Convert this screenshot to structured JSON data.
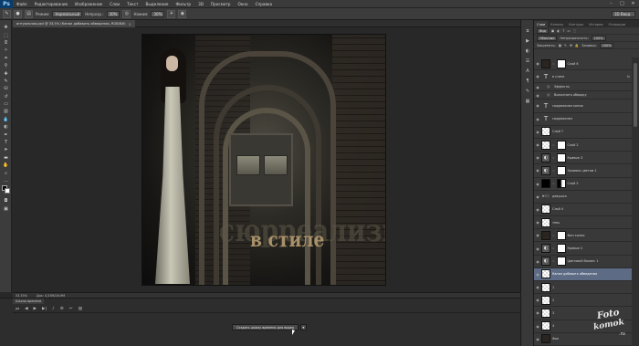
{
  "menubar": {
    "logo": "Ps",
    "items": [
      "Файл",
      "Редактирование",
      "Изображение",
      "Слои",
      "Текст",
      "Выделение",
      "Фильтр",
      "3D",
      "Просмотр",
      "Окно",
      "Справка"
    ]
  },
  "options": {
    "mode_label": "Режим:",
    "mode_value": "Нормальный",
    "opacity_label": "Непрозр.:",
    "opacity_value": "30%",
    "flow_label": "Нажим:",
    "flow_value": "30%",
    "workspace": "3D Ввод"
  },
  "document": {
    "tab_title": "интуальная.psd @ 33,5% (Канал добавить обведения, RGB/8#)",
    "headline_back": "сюрреализм",
    "headline_front": "в стиле"
  },
  "status": {
    "zoom": "33,33%",
    "doc": "Док: 4,53М/26,9М"
  },
  "timeline": {
    "tab": "Шкала времени",
    "create_button": "Создать шкалу времени для видео"
  },
  "layers_panel": {
    "tabs": [
      "Слои",
      "Каналы",
      "Контуры",
      "История",
      "Операции"
    ],
    "kind_label": "Вид",
    "blend_mode": "Обычные",
    "opacity_label": "Непрозрачность:",
    "opacity_value": "100%",
    "lock_label": "Закрепить:",
    "fill_label": "Заливка:",
    "fill_value": "100%",
    "layers": [
      {
        "name": "Слой 6",
        "thumb": "dark",
        "mask": true,
        "sub": false
      },
      {
        "name": "в стиле",
        "thumb": "text",
        "mask": false,
        "sub": false,
        "fx": "fx"
      },
      {
        "name": "Эффекты",
        "thumb": "none",
        "mask": false,
        "sub": true
      },
      {
        "name": "Выполнить обводку",
        "thumb": "none",
        "mask": false,
        "sub": true
      },
      {
        "name": "сюрреализм копия",
        "thumb": "text",
        "mask": false,
        "sub": false
      },
      {
        "name": "сюрреализм",
        "thumb": "text",
        "mask": false,
        "sub": false
      },
      {
        "name": "Слой 7",
        "thumb": "checker",
        "mask": false,
        "sub": false
      },
      {
        "name": "Слой 2",
        "thumb": "checker",
        "mask": true,
        "sub": false
      },
      {
        "name": "Кривые 3",
        "thumb": "adj",
        "mask": true,
        "sub": false
      },
      {
        "name": "Заливка цветом 1",
        "thumb": "adj",
        "mask": true,
        "sub": false
      },
      {
        "name": "Слой 5",
        "thumb": "black",
        "mask": true,
        "sub": false
      },
      {
        "name": "девушка",
        "thumb": "folder",
        "mask": false,
        "sub": false
      },
      {
        "name": "Слой 4",
        "thumb": "checker",
        "mask": false,
        "sub": false
      },
      {
        "name": "тень",
        "thumb": "checker",
        "mask": false,
        "sub": false
      },
      {
        "name": "Фон копия",
        "thumb": "dark",
        "mask": true,
        "sub": false
      },
      {
        "name": "Кривые 2",
        "thumb": "adj",
        "mask": true,
        "sub": false
      },
      {
        "name": "Цветовой баланс 1",
        "thumb": "adj",
        "mask": true,
        "sub": false
      },
      {
        "name": "Канал добавить обведения",
        "thumb": "checker",
        "mask": false,
        "sub": false,
        "selected": true
      },
      {
        "name": "1",
        "thumb": "checker",
        "mask": false,
        "sub": false
      },
      {
        "name": "2",
        "thumb": "checker",
        "mask": false,
        "sub": false
      },
      {
        "name": "3",
        "thumb": "checker",
        "mask": false,
        "sub": false
      },
      {
        "name": "4",
        "thumb": "checker",
        "mask": false,
        "sub": false
      },
      {
        "name": "Фон",
        "thumb": "dark",
        "mask": false,
        "sub": false
      }
    ]
  },
  "watermark": {
    "line1": "Foto",
    "line2": "komok",
    "line3": ".ru"
  }
}
